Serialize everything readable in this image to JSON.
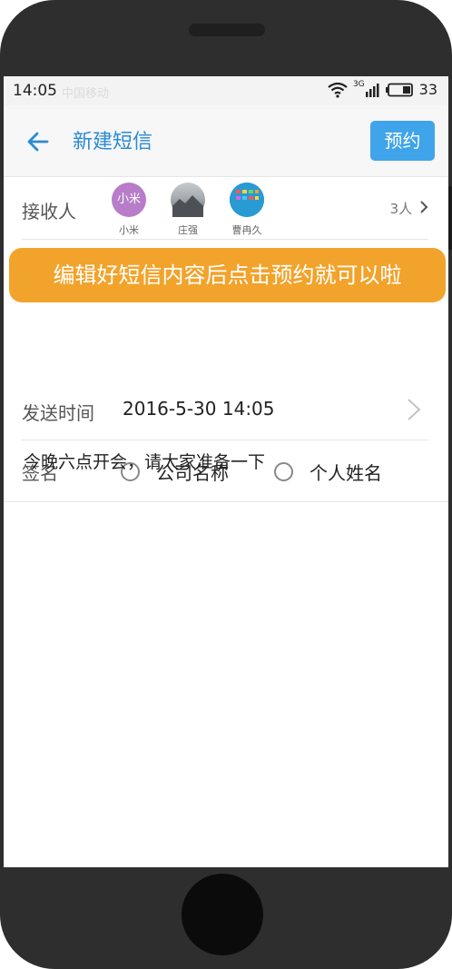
{
  "status": {
    "time": "14:05",
    "carrier": "中国移动",
    "network": "3G",
    "battery": "33"
  },
  "header": {
    "title": "新建短信",
    "book_button": "预约"
  },
  "recipients": {
    "label": "接收人",
    "count": "3人",
    "people": [
      {
        "name": "小米",
        "avatar_text": "小米",
        "color": "#b77dc9"
      },
      {
        "name": "庄强",
        "avatar_text": "",
        "color": "#9ea3a8"
      },
      {
        "name": "曹冉久",
        "avatar_text": "",
        "color": "#2f8fc6"
      }
    ]
  },
  "banner": {
    "text": "编辑好短信内容后点击预约就可以啦"
  },
  "send_time": {
    "label": "发送时间",
    "value": "2016-5-30 14:05"
  },
  "signature": {
    "label": "签名",
    "options": [
      "公司名称",
      "个人姓名"
    ]
  },
  "message": {
    "body": "今晚六点开会，请大家准备一下"
  },
  "colors": {
    "accent": "#3fa4ea",
    "banner": "#f2a32b",
    "title": "#2a8ad6"
  }
}
